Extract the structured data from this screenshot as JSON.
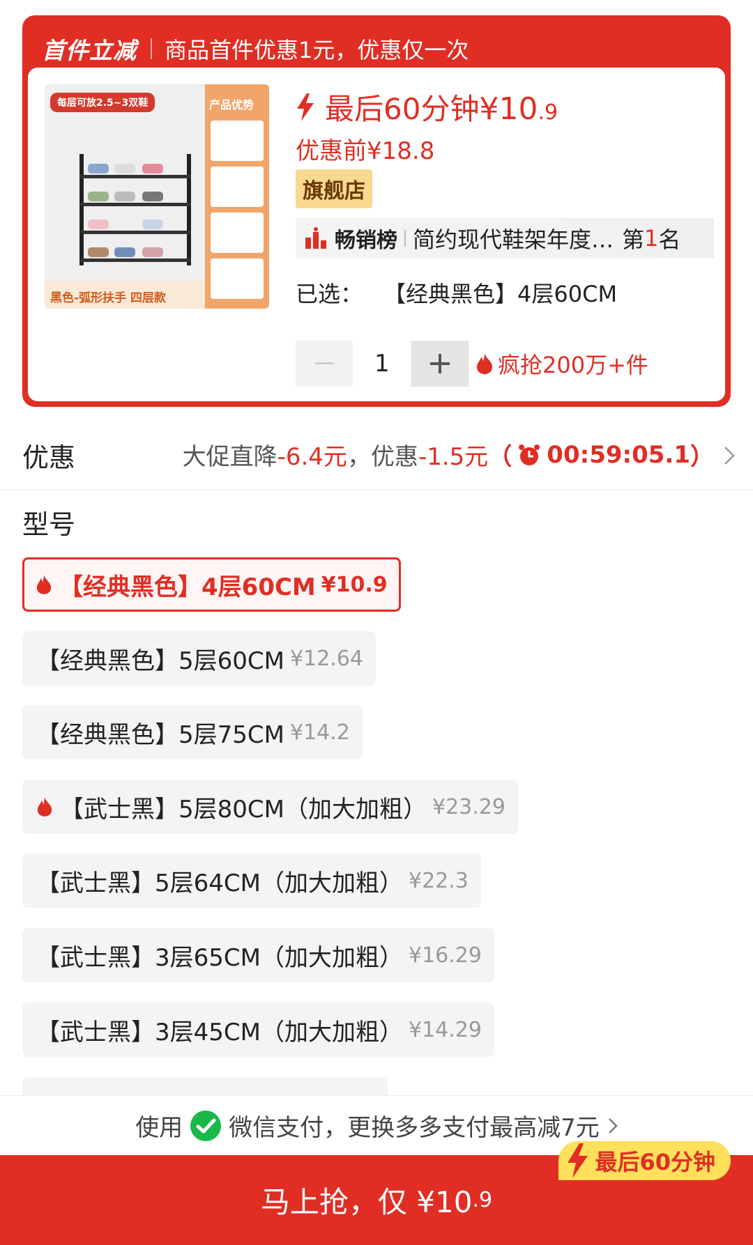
{
  "banner": {
    "title": "首件立减",
    "subtitle": "商品首件优惠1元，优惠仅一次"
  },
  "product_image": {
    "top_tag": "每层可放2.5~3双鞋",
    "side_title": "产品优势",
    "bottom_caption": "黑色-弧形扶手 四层款"
  },
  "product": {
    "flash_label": "最后60分钟",
    "flash_price_int": "¥10",
    "flash_price_dec": ".9",
    "original_price": "优惠前¥18.8",
    "store_badge": "旗舰店",
    "rank_title": "畅销榜",
    "rank_desc": "简约现代鞋架年度…",
    "rank_prefix": "第",
    "rank_num": "1",
    "rank_suffix": "名",
    "selected_label": "已选：",
    "selected_value": "【经典黑色】4层60CM",
    "quantity": "1",
    "hot_sales": "疯抢200万+件"
  },
  "discount": {
    "label": "优惠",
    "promo_prefix": "大促直降",
    "promo_value": "-6.4元",
    "sep": "，优惠",
    "coupon_value": "-1.5元",
    "paren_open": "（",
    "timer": "00:59:05.1",
    "paren_close": "）"
  },
  "model": {
    "title": "型号",
    "options": [
      {
        "name": "【经典黑色】4层60CM",
        "price": "¥10.9",
        "hot": true,
        "selected": true
      },
      {
        "name": "【经典黑色】5层60CM",
        "price": "¥12.64",
        "hot": false,
        "selected": false
      },
      {
        "name": "【经典黑色】5层75CM",
        "price": "¥14.2",
        "hot": false,
        "selected": false
      },
      {
        "name": "【武士黑】5层80CM（加大加粗）",
        "price": "¥23.29",
        "hot": true,
        "selected": false
      },
      {
        "name": "【武士黑】5层64CM（加大加粗）",
        "price": "¥22.3",
        "hot": false,
        "selected": false
      },
      {
        "name": "【武士黑】3层65CM（加大加粗）",
        "price": "¥16.29",
        "hot": false,
        "selected": false
      },
      {
        "name": "【武士黑】3层45CM（加大加粗）",
        "price": "¥14.29",
        "hot": false,
        "selected": false
      }
    ]
  },
  "pay_hint": {
    "prefix": "使用",
    "method": "微信支付，更换多多支付最高减7元"
  },
  "buy": {
    "label": "马上抢，仅 ¥10",
    "price_dec": ".9",
    "countdown_tag": "最后60分钟"
  },
  "colors": {
    "brand_red": "#e02e24",
    "badge_gold": "#f8d98f",
    "countdown_yellow": "#ffe05a"
  }
}
